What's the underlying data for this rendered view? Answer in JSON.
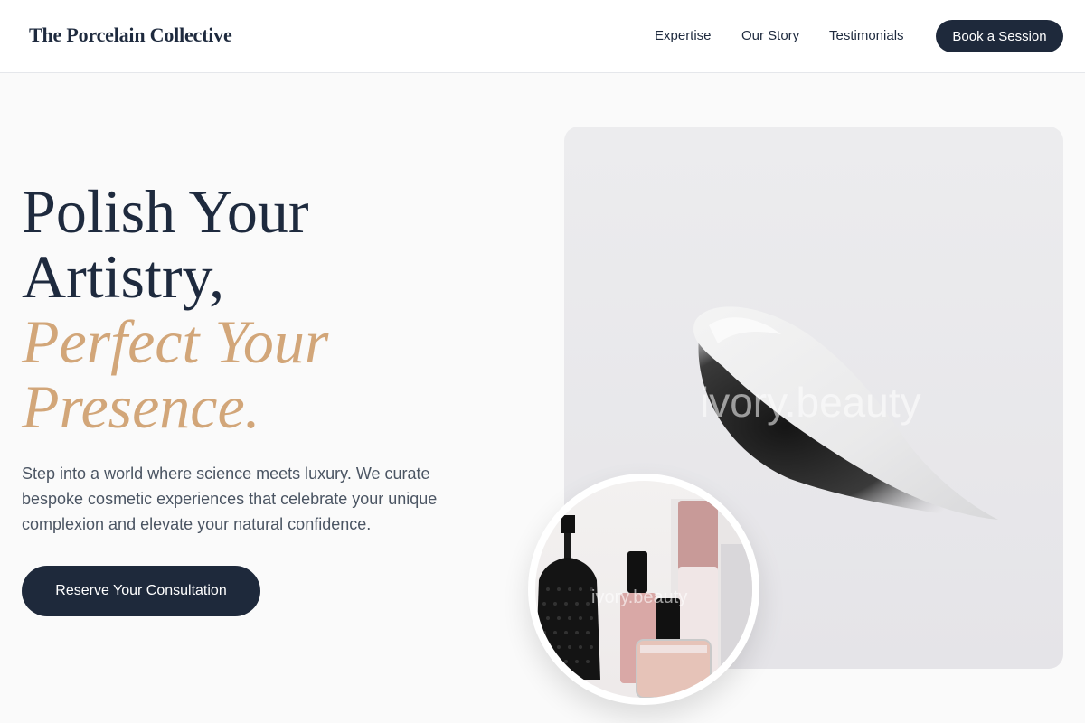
{
  "header": {
    "brand": "The Porcelain Collective",
    "nav": [
      {
        "label": "Expertise"
      },
      {
        "label": "Our Story"
      },
      {
        "label": "Testimonials"
      }
    ],
    "cta_label": "Book a Session"
  },
  "hero": {
    "headline_lines": [
      "Polish Your",
      "Artistry,"
    ],
    "headline_accent_lines": [
      "Perfect Your",
      "Presence."
    ],
    "description": "Step into a world where science meets luxury. We curate bespoke cosmetic experiences that celebrate your unique complexion and elevate your natural confidence.",
    "cta_label": "Reserve Your Consultation"
  },
  "media": {
    "main_watermark": "ivory.beauty",
    "inset_watermark": "ivory.beauty"
  },
  "colors": {
    "primary": "#1e293b",
    "accent": "#d2a679",
    "background": "#fafafa"
  }
}
